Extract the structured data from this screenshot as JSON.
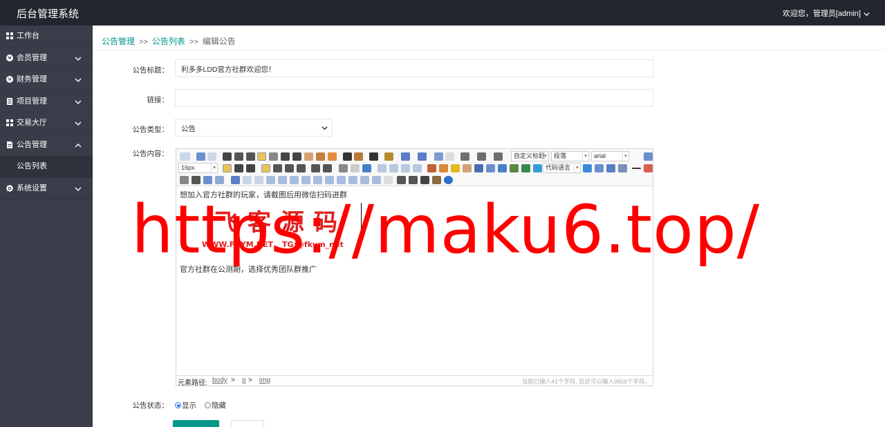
{
  "app": {
    "title": "后台管理系统",
    "user": "欢迎您，管理员[admin]"
  },
  "sidebar": {
    "items": [
      {
        "label": "工作台",
        "icon": "dashboard-icon",
        "expandable": false
      },
      {
        "label": "会员管理",
        "icon": "member-icon",
        "expandable": true
      },
      {
        "label": "财务管理",
        "icon": "finance-icon",
        "expandable": true
      },
      {
        "label": "项目管理",
        "icon": "project-icon",
        "expandable": true
      },
      {
        "label": "交易大厅",
        "icon": "trade-icon",
        "expandable": true
      },
      {
        "label": "公告管理",
        "icon": "notice-icon",
        "expandable": true,
        "expanded": true
      },
      {
        "label": "系统设置",
        "icon": "gear-icon",
        "expandable": true
      }
    ],
    "sub_items": [
      {
        "label": "公告列表"
      }
    ]
  },
  "breadcrumb": {
    "items": [
      "公告管理",
      "公告列表",
      "编辑公告"
    ],
    "sep": ">>"
  },
  "form": {
    "title_label": "公告标题：",
    "title_value": "利多多LDD官方社群欢迎您！",
    "link_label": "链接：",
    "link_value": "",
    "type_label": "公告类型：",
    "type_value": "公告",
    "content_label": "公告内容：",
    "status_label": "公告状态：",
    "status_options": [
      "显示",
      "隐藏"
    ],
    "status_selected": "显示"
  },
  "editor": {
    "combos": {
      "heading": "自定义标题",
      "paragraph": "段落",
      "font": "arial",
      "size": "16px",
      "code": "代码语言"
    },
    "lines": [
      "想加入官方社群的玩家，请截图后用微信扫码进群",
      "官方社群在公测期，选择优秀团队群推广"
    ],
    "logo_title": "飞客源码",
    "logo_url": "WWW.FKYM.NET",
    "logo_tg": "TG:@fkym_net",
    "status_path_label": "元素路径:",
    "status_path": [
      "body",
      "p",
      "img"
    ],
    "status_count": "当前已输入41个字符, 您还可以输入9959个字符。"
  },
  "watermark": "https://maku6.top/",
  "colors": {
    "accent": "#009688",
    "topbar": "#23262e",
    "sidebar": "#393d49",
    "watermark": "#ff0000"
  }
}
